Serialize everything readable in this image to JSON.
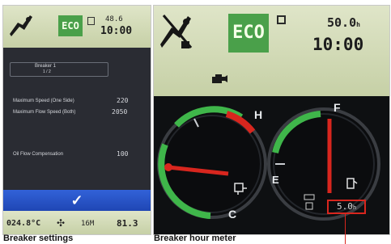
{
  "breaker_settings_screen": {
    "eco_label": "ECO",
    "top_value": "48.6",
    "clock": "10:00",
    "menu_title": "Breaker 1",
    "menu_subtitle": "1 / 2",
    "settings": [
      {
        "label": "Maximum Speed (One Side)",
        "value": "220"
      },
      {
        "label": "Maximum Flow Speed (Both)",
        "value": "2050"
      },
      {
        "label": "Oil Flow Compensation",
        "value": "100"
      }
    ],
    "confirm_glyph": "✓",
    "status_temp": "024.8°C",
    "status_mode": "16M",
    "status_hours": "81.3",
    "caption": "Breaker settings"
  },
  "hour_meter_screen": {
    "eco_label": "ECO",
    "hours_value": "50.0",
    "hours_unit": "h",
    "clock": "10:00",
    "coolant_hot_label": "H",
    "coolant_cold_label": "C",
    "fuel_full_label": "F",
    "fuel_empty_label": "E",
    "breaker_hours": "5.0",
    "breaker_hours_unit": "h",
    "caption": "Breaker hour meter"
  },
  "colors": {
    "eco_green": "#4aa04a",
    "accent_red": "#d8261e",
    "gauge_green": "#3fb64a",
    "confirm_blue": "#2552c8"
  },
  "icons": [
    "breaker-attachment-icon",
    "engine-icon",
    "fuel-pump-icon",
    "coolant-icon",
    "hour-meter-icon",
    "confirm-check-icon"
  ]
}
